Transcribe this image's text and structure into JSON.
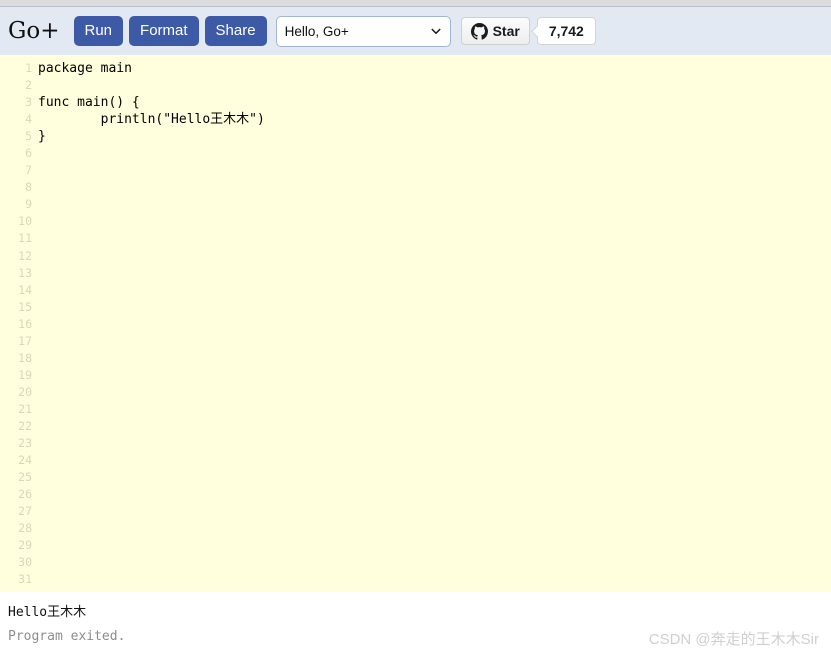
{
  "toolbar": {
    "brand": "Go+",
    "buttons": [
      {
        "name": "run",
        "label": "Run"
      },
      {
        "name": "format",
        "label": "Format"
      },
      {
        "name": "share",
        "label": "Share"
      }
    ],
    "example_select": {
      "value": "Hello, Go+",
      "icon": "chevron-down-icon"
    },
    "github": {
      "icon": "github-icon",
      "label": "Star",
      "count": "7,742"
    }
  },
  "editor": {
    "lines": [
      {
        "n": "1",
        "text": "package main"
      },
      {
        "n": "2",
        "text": ""
      },
      {
        "n": "3",
        "text": "func main() {"
      },
      {
        "n": "4",
        "text": "        println(\"Hello王木木\")"
      },
      {
        "n": "5",
        "text": "}"
      },
      {
        "n": "6",
        "text": ""
      },
      {
        "n": "7",
        "text": ""
      },
      {
        "n": "8",
        "text": ""
      },
      {
        "n": "9",
        "text": ""
      },
      {
        "n": "10",
        "text": ""
      },
      {
        "n": "11",
        "text": ""
      },
      {
        "n": "12",
        "text": ""
      },
      {
        "n": "13",
        "text": ""
      },
      {
        "n": "14",
        "text": ""
      },
      {
        "n": "15",
        "text": ""
      },
      {
        "n": "16",
        "text": ""
      },
      {
        "n": "17",
        "text": ""
      },
      {
        "n": "18",
        "text": ""
      },
      {
        "n": "19",
        "text": ""
      },
      {
        "n": "20",
        "text": ""
      },
      {
        "n": "21",
        "text": ""
      },
      {
        "n": "22",
        "text": ""
      },
      {
        "n": "23",
        "text": ""
      },
      {
        "n": "24",
        "text": ""
      },
      {
        "n": "25",
        "text": ""
      },
      {
        "n": "26",
        "text": ""
      },
      {
        "n": "27",
        "text": ""
      },
      {
        "n": "28",
        "text": ""
      },
      {
        "n": "29",
        "text": ""
      },
      {
        "n": "30",
        "text": ""
      },
      {
        "n": "31",
        "text": ""
      }
    ]
  },
  "console": {
    "stdout": "Hello王木木",
    "status": "Program exited."
  },
  "watermark": "CSDN @奔走的王木木Sir",
  "colors": {
    "toolbar_bg": "#e2e9f3",
    "button_blue": "#3c5aa6",
    "editor_bg": "#ffffdd",
    "line_number": "#d8d8b8",
    "status_text": "#8d8d8d",
    "watermark": "#cfcfcf"
  }
}
